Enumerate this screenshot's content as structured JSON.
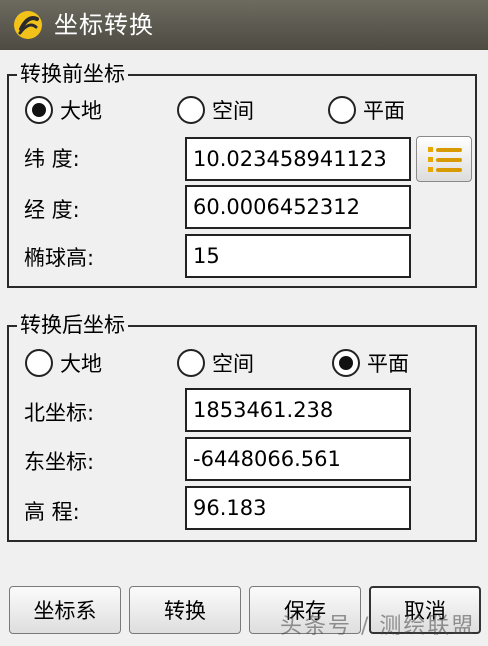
{
  "window": {
    "title": "坐标转换"
  },
  "before": {
    "legend": "转换前坐标",
    "radios": [
      {
        "label": "大地",
        "checked": true
      },
      {
        "label": "空间",
        "checked": false
      },
      {
        "label": "平面",
        "checked": false
      }
    ],
    "fields": [
      {
        "label": "纬 度:",
        "value": "10.023458941123"
      },
      {
        "label": "经 度:",
        "value": "60.0006452312"
      },
      {
        "label": "椭球高:",
        "value": "15"
      }
    ]
  },
  "after": {
    "legend": "转换后坐标",
    "radios": [
      {
        "label": "大地",
        "checked": false
      },
      {
        "label": "空间",
        "checked": false
      },
      {
        "label": "平面",
        "checked": true
      }
    ],
    "fields": [
      {
        "label": "北坐标:",
        "value": "1853461.238"
      },
      {
        "label": "东坐标:",
        "value": "-6448066.561"
      },
      {
        "label": "高 程:",
        "value": "96.183"
      }
    ]
  },
  "buttons": {
    "coord_system": "坐标系",
    "convert": "转换",
    "save": "保存",
    "cancel": "取消"
  },
  "watermark": "头条号 / 测绘联盟"
}
